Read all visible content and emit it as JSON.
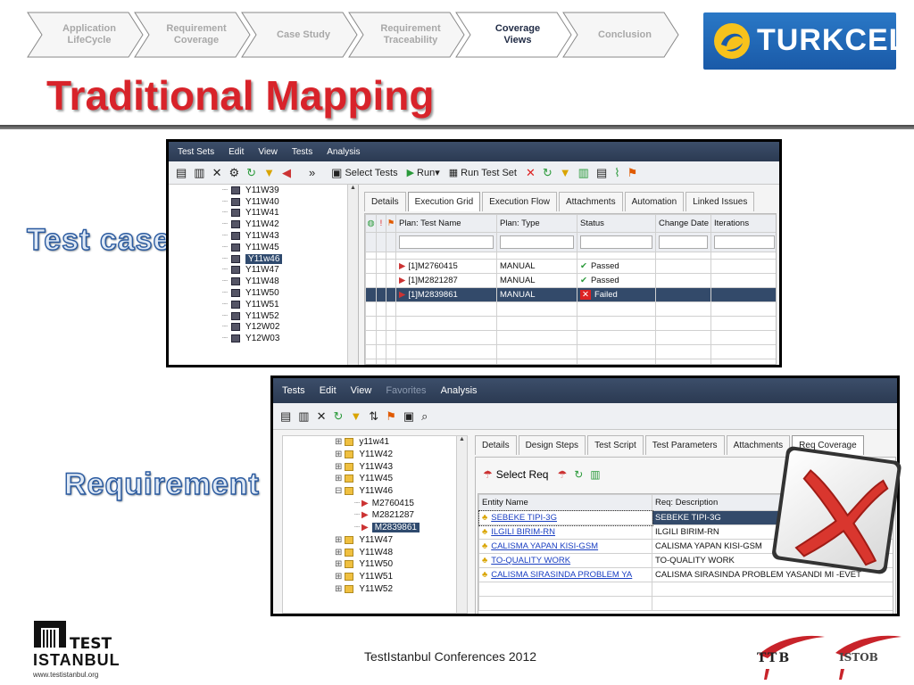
{
  "breadcrumbs": [
    {
      "label": "Application\nLifeCycle",
      "active": false
    },
    {
      "label": "Requirement\nCoverage",
      "active": false
    },
    {
      "label": "Case Study",
      "active": false
    },
    {
      "label": "Requirement\nTraceability",
      "active": false
    },
    {
      "label": "Coverage\nViews",
      "active": true
    },
    {
      "label": "Conclusion",
      "active": false
    }
  ],
  "logo": {
    "text": "TURKCELL"
  },
  "title": "Traditional Mapping",
  "labels": {
    "test_case": "Test case",
    "requirement": "Requirement"
  },
  "window1": {
    "menu": [
      "Test Sets",
      "Edit",
      "View",
      "Tests",
      "Analysis"
    ],
    "toolbar": {
      "select_tests": "Select Tests",
      "run": "Run",
      "run_test_set": "Run Test Set"
    },
    "tree": [
      "Y11W39",
      "Y11W40",
      "Y11W41",
      "Y11W42",
      "Y11W43",
      "Y11W45",
      "Y11w46",
      "Y11W47",
      "Y11W48",
      "Y11W50",
      "Y11W51",
      "Y11W52",
      "Y12W02",
      "Y12W03"
    ],
    "selected_index": 6,
    "tabs": [
      "Details",
      "Execution Grid",
      "Execution Flow",
      "Attachments",
      "Automation",
      "Linked Issues"
    ],
    "active_tab": 1,
    "columns": [
      "Plan: Test Name",
      "Plan: Type",
      "Status",
      "Change Date",
      "Iterations"
    ],
    "rows": [
      {
        "name": "[1]M2760415",
        "type": "MANUAL",
        "status": "Passed"
      },
      {
        "name": "[1]M2821287",
        "type": "MANUAL",
        "status": "Passed"
      },
      {
        "name": "[1]M2839861",
        "type": "MANUAL",
        "status": "Failed"
      }
    ]
  },
  "window2": {
    "menu": [
      "Tests",
      "Edit",
      "View",
      "Favorites",
      "Analysis"
    ],
    "tree": [
      {
        "label": "y11w41",
        "kind": "folder",
        "indent": 0
      },
      {
        "label": "Y11W42",
        "kind": "folder",
        "indent": 0
      },
      {
        "label": "Y11W43",
        "kind": "folder",
        "indent": 0
      },
      {
        "label": "Y11W45",
        "kind": "folder",
        "indent": 0
      },
      {
        "label": "Y11W46",
        "kind": "folder-open",
        "indent": 0
      },
      {
        "label": "M2760415",
        "kind": "test",
        "indent": 1
      },
      {
        "label": "M2821287",
        "kind": "test",
        "indent": 1
      },
      {
        "label": "M2839861",
        "kind": "test",
        "indent": 1,
        "selected": true
      },
      {
        "label": "Y11W47",
        "kind": "folder",
        "indent": 0
      },
      {
        "label": "Y11W48",
        "kind": "folder",
        "indent": 0
      },
      {
        "label": "Y11W50",
        "kind": "folder",
        "indent": 0
      },
      {
        "label": "Y11W51",
        "kind": "folder",
        "indent": 0
      },
      {
        "label": "Y11W52",
        "kind": "folder",
        "indent": 0
      }
    ],
    "tabs": [
      "Details",
      "Design Steps",
      "Test Script",
      "Test Parameters",
      "Attachments",
      "Req Coverage"
    ],
    "active_tab": 5,
    "select_req": "Select Req",
    "columns": [
      "Entity Name",
      "Req: Description"
    ],
    "rows": [
      {
        "name": "SEBEKE TIPI-3G",
        "desc": "SEBEKE TIPI-3G",
        "selected": true
      },
      {
        "name": "ILGILI BIRIM-RN",
        "desc": "ILGILI BIRIM-RN"
      },
      {
        "name": "CALISMA YAPAN KISI-GSM",
        "desc": "CALISMA YAPAN KISI-GSM"
      },
      {
        "name": "TO-QUALITY WORK",
        "desc": "TO-QUALITY WORK"
      },
      {
        "name": "CALISMA SIRASINDA PROBLEM YA",
        "desc": "CALISMA SIRASINDA PROBLEM YASANDI MI -EVET"
      }
    ]
  },
  "footer": {
    "text": "TestIstanbul Conferences 2012",
    "url": "www.testistanbul.org",
    "ttb": "TTB",
    "istob": "ISTOB",
    "ti_top": "TEST",
    "ti_bottom": "ISTANBUL"
  }
}
